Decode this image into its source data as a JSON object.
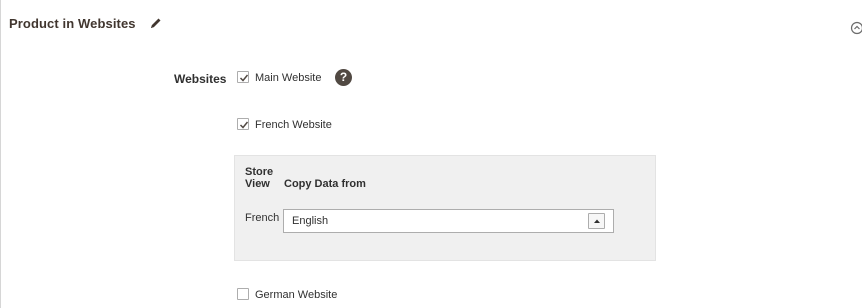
{
  "section": {
    "title": "Product in Websites",
    "edit_icon": "pencil-icon",
    "collapse_icon": "collapse-circle-icon"
  },
  "websites": {
    "label": "Websites",
    "help_icon_glyph": "?",
    "items": [
      {
        "label": "Main Website",
        "checked": true
      },
      {
        "label": "French Website",
        "checked": true
      },
      {
        "label": "German Website",
        "checked": false
      }
    ]
  },
  "store_view_table": {
    "headers": {
      "store_view_line1": "Store",
      "store_view_line2": "View",
      "copy_data_from": "Copy Data from"
    },
    "rows": [
      {
        "store_view": "French",
        "copy_from": "English"
      }
    ]
  }
}
